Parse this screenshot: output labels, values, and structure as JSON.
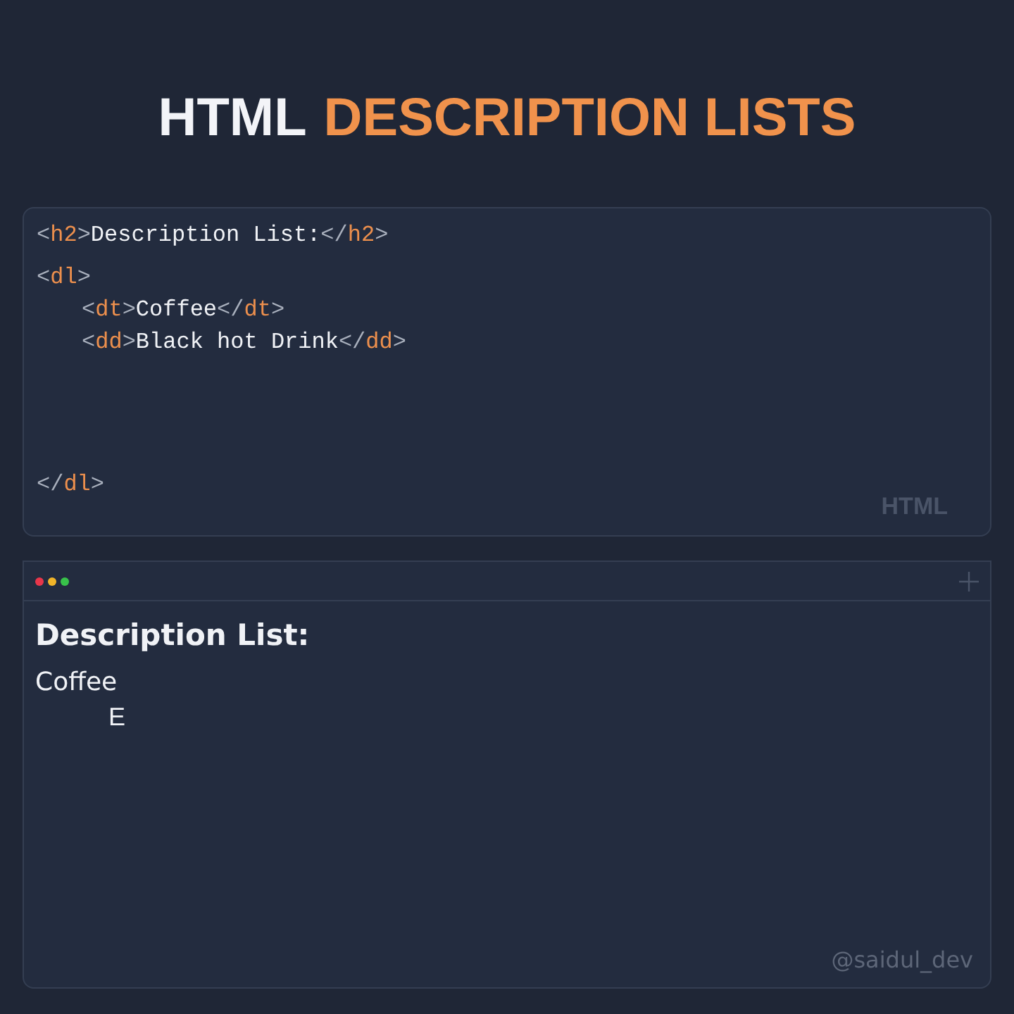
{
  "headline": [
    {
      "kind": "plain",
      "text": "HTML"
    },
    {
      "kind": "accent",
      "text": "DESCRIPTION LISTS"
    }
  ],
  "code": {
    "language": "HTML",
    "lines": [
      {
        "tokens": [
          {
            "kind": "punct",
            "text": "<"
          },
          {
            "kind": "tag",
            "text": "h2"
          },
          {
            "kind": "punct",
            "text": ">"
          },
          {
            "kind": "text",
            "text": "Description List:"
          },
          {
            "kind": "punct",
            "text": "</"
          },
          {
            "kind": "tag",
            "text": "h2"
          },
          {
            "kind": "punct",
            "text": ">"
          }
        ]
      },
      {
        "tokens": [
          {
            "kind": "punct",
            "text": "<"
          },
          {
            "kind": "tag",
            "text": "dl"
          },
          {
            "kind": "punct",
            "text": ">"
          }
        ],
        "children": [
          {
            "tokens": [
              {
                "kind": "punct",
                "text": "<"
              },
              {
                "kind": "tag",
                "text": "dt"
              },
              {
                "kind": "punct",
                "text": ">"
              },
              {
                "kind": "text",
                "text": "Coffee"
              },
              {
                "kind": "punct",
                "text": "</"
              },
              {
                "kind": "tag",
                "text": "dt"
              },
              {
                "kind": "punct",
                "text": ">"
              }
            ]
          },
          {
            "tokens": [
              {
                "kind": "punct",
                "text": "<"
              },
              {
                "kind": "tag",
                "text": "dd"
              },
              {
                "kind": "punct",
                "text": ">"
              },
              {
                "kind": "text",
                "text": "Black hot Drink"
              },
              {
                "kind": "punct",
                "text": "</"
              },
              {
                "kind": "tag",
                "text": "dd"
              },
              {
                "kind": "punct",
                "text": ">"
              }
            ]
          }
        ],
        "end": [
          {
            "kind": "punct",
            "text": "</"
          },
          {
            "kind": "tag",
            "text": "dl"
          },
          {
            "kind": "punct",
            "text": ">"
          }
        ]
      }
    ]
  },
  "preview": {
    "window_controls": [
      {
        "color": "#e8364a"
      },
      {
        "color": "#f0b429"
      },
      {
        "color": "#38c24a"
      }
    ],
    "heading": "Description List:",
    "term": "Coffee",
    "description": "E",
    "credit": "@saidul_dev"
  }
}
